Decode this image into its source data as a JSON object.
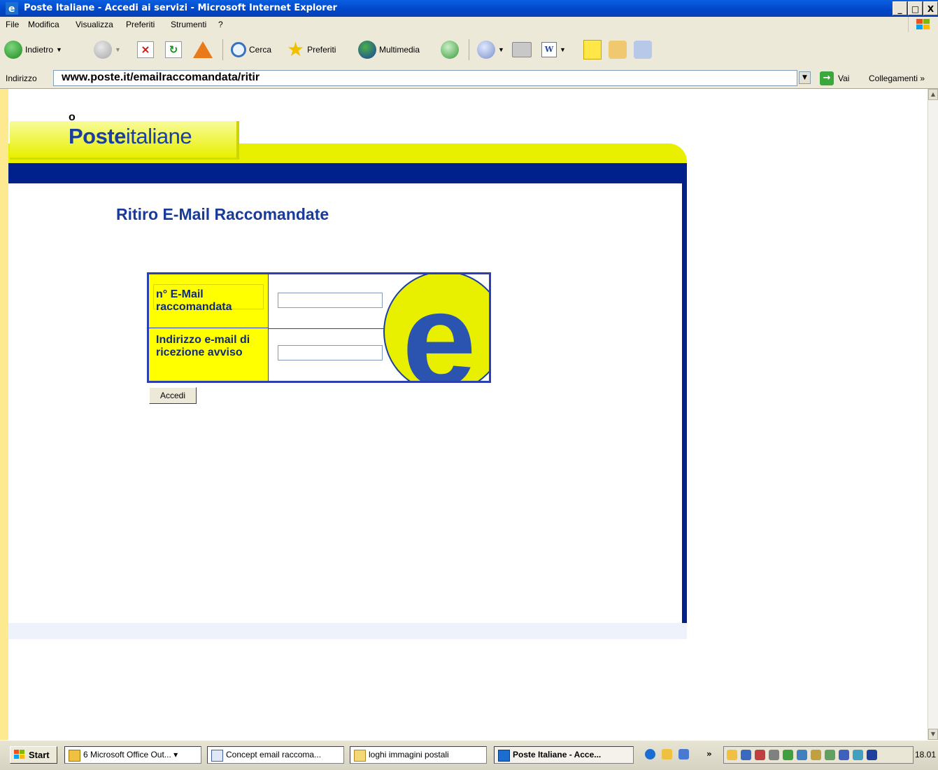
{
  "window": {
    "title": "Poste Italiane - Accedi ai servizi - Microsoft Internet Explorer",
    "controls": [
      "_",
      "̸",
      "X"
    ]
  },
  "menu": {
    "items": [
      "File",
      "Modifica",
      "Visualizza",
      "Preferiti",
      "Strumenti",
      "?"
    ]
  },
  "toolbar": {
    "back_label": "Indietro",
    "search_label": "Cerca",
    "favorites_label": "Preferiti",
    "multimedia_label": "Multimedia"
  },
  "address": {
    "label": "Indirizzo",
    "url": "www.poste.it/emailraccomandata/ritir",
    "go_label": "Vai",
    "links_label": "Collegamenti"
  },
  "page": {
    "top_o": "o",
    "logo_bold": "Poste",
    "logo_light": "italiane",
    "heading": "Ritiro E-Mail Raccomandate",
    "form": {
      "field1_label": "n° E-Mail raccomandata",
      "field1_value": "",
      "field2_label": "Indirizzo e-mail di ricezione avviso",
      "field2_value": "",
      "emblem_letter": "e",
      "submit_label": "Accedi"
    }
  },
  "taskbar": {
    "start_label": "Start",
    "buttons": [
      {
        "label": "6 Microsoft Office Out...",
        "icon": "outlook-icon"
      },
      {
        "label": "Concept email raccoma...",
        "icon": "document-icon"
      },
      {
        "label": "loghi immagini postali",
        "icon": "folder-icon"
      },
      {
        "label": "Poste Italiane - Acce...",
        "icon": "ie-icon",
        "active": true
      }
    ],
    "clock": "18.01"
  },
  "colors": {
    "poste_blue": "#00208c",
    "poste_yellow": "#e8f000",
    "heading_blue": "#1a3a9a"
  }
}
